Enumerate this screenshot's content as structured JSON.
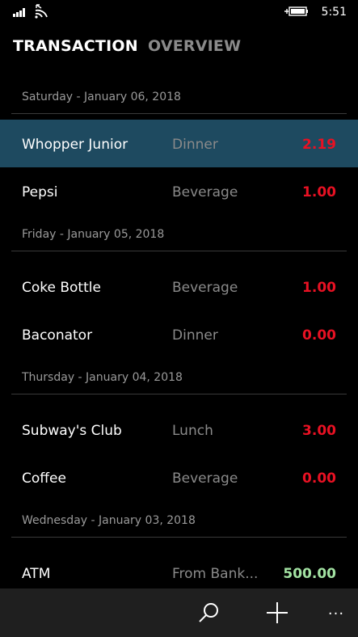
{
  "status_bar": {
    "time": "5:51",
    "icons": [
      "signal-bars-icon",
      "wifi-icon",
      "battery-charging-icon"
    ]
  },
  "pivot": {
    "tabs": [
      {
        "label": "TRANSACTION",
        "active": true
      },
      {
        "label": "OVERVIEW",
        "active": false
      }
    ]
  },
  "groups": [
    {
      "date": "Saturday - January 06, 2018",
      "items": [
        {
          "name": "Whopper Junior",
          "category": "Dinner",
          "amount": "2.19",
          "type": "expense",
          "selected": true
        },
        {
          "name": "Pepsi",
          "category": "Beverage",
          "amount": "1.00",
          "type": "expense",
          "selected": false
        }
      ]
    },
    {
      "date": "Friday - January 05, 2018",
      "items": [
        {
          "name": "Coke Bottle",
          "category": "Beverage",
          "amount": "1.00",
          "type": "expense",
          "selected": false
        },
        {
          "name": "Baconator",
          "category": "Dinner",
          "amount": "0.00",
          "type": "expense",
          "selected": false
        }
      ]
    },
    {
      "date": "Thursday - January 04, 2018",
      "items": [
        {
          "name": "Subway's Club",
          "category": "Lunch",
          "amount": "3.00",
          "type": "expense",
          "selected": false
        },
        {
          "name": "Coffee",
          "category": "Beverage",
          "amount": "0.00",
          "type": "expense",
          "selected": false
        }
      ]
    },
    {
      "date": "Wednesday - January 03, 2018",
      "items": [
        {
          "name": "ATM",
          "category": "From Bank...",
          "amount": "500.00",
          "type": "income",
          "selected": false
        }
      ]
    }
  ],
  "app_bar": {
    "buttons": [
      "search-icon",
      "add-icon",
      "more-icon"
    ],
    "more_label": "..."
  },
  "colors": {
    "background": "#000000",
    "selected_row": "#1e4a60",
    "expense": "#e81123",
    "income": "#a3e3a3",
    "secondary_text": "#8a8a8a",
    "app_bar": "#1f1f1f"
  }
}
